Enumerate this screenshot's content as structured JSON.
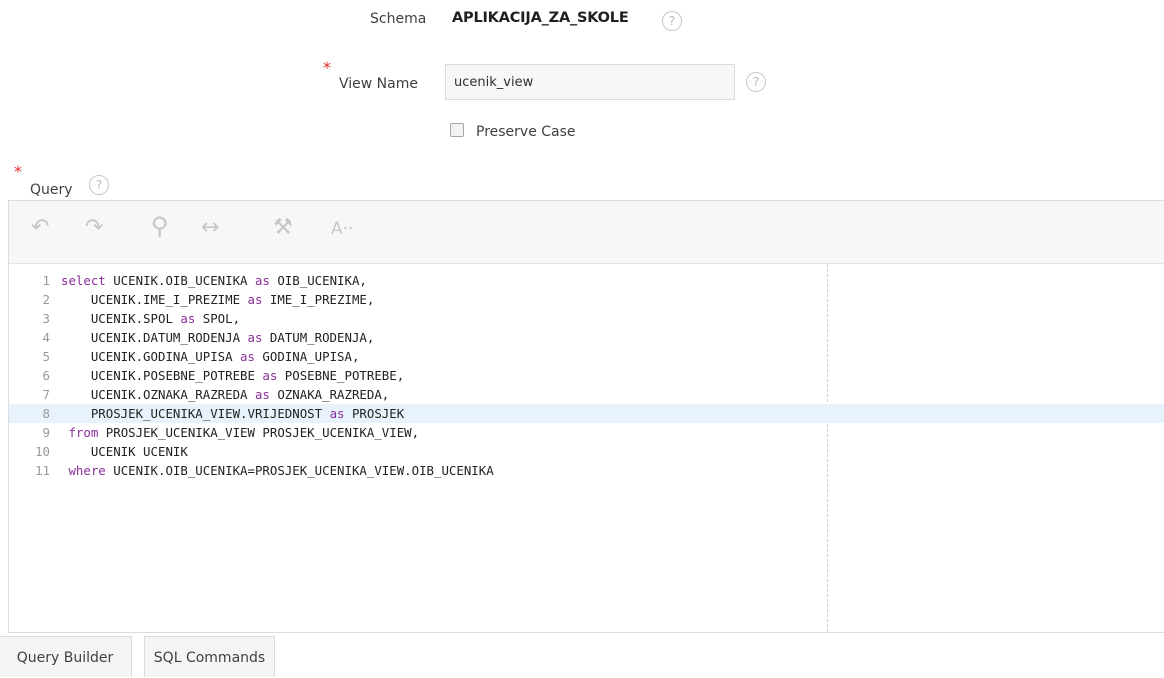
{
  "schema": {
    "label": "Schema",
    "value": "APLIKACIJA_ZA_SKOLE",
    "help": "?"
  },
  "view_name": {
    "required": "*",
    "label": "View Name",
    "value": "ucenik_view",
    "help": "?"
  },
  "preserve_case": {
    "label": "Preserve Case",
    "checked": false
  },
  "query": {
    "required": "*",
    "label": "Query",
    "help": "?",
    "toolbar": {
      "undo": "↶",
      "redo": "↷",
      "search": "⚲",
      "replace": "↔",
      "format": "⚒",
      "font": "A··"
    },
    "active_line": 8,
    "lines": [
      {
        "n": "1",
        "indent": "",
        "parts": [
          {
            "k": true,
            "t": "select"
          },
          {
            "k": false,
            "t": " UCENIK.OIB_UCENIKA "
          },
          {
            "k": true,
            "t": "as"
          },
          {
            "k": false,
            "t": " OIB_UCENIKA,"
          }
        ]
      },
      {
        "n": "2",
        "indent": "    ",
        "parts": [
          {
            "k": false,
            "t": "UCENIK.IME_I_PREZIME "
          },
          {
            "k": true,
            "t": "as"
          },
          {
            "k": false,
            "t": " IME_I_PREZIME,"
          }
        ]
      },
      {
        "n": "3",
        "indent": "    ",
        "parts": [
          {
            "k": false,
            "t": "UCENIK.SPOL "
          },
          {
            "k": true,
            "t": "as"
          },
          {
            "k": false,
            "t": " SPOL,"
          }
        ]
      },
      {
        "n": "4",
        "indent": "    ",
        "parts": [
          {
            "k": false,
            "t": "UCENIK.DATUM_RODENJA "
          },
          {
            "k": true,
            "t": "as"
          },
          {
            "k": false,
            "t": " DATUM_RODENJA,"
          }
        ]
      },
      {
        "n": "5",
        "indent": "    ",
        "parts": [
          {
            "k": false,
            "t": "UCENIK.GODINA_UPISA "
          },
          {
            "k": true,
            "t": "as"
          },
          {
            "k": false,
            "t": " GODINA_UPISA,"
          }
        ]
      },
      {
        "n": "6",
        "indent": "    ",
        "parts": [
          {
            "k": false,
            "t": "UCENIK.POSEBNE_POTREBE "
          },
          {
            "k": true,
            "t": "as"
          },
          {
            "k": false,
            "t": " POSEBNE_POTREBE,"
          }
        ]
      },
      {
        "n": "7",
        "indent": "    ",
        "parts": [
          {
            "k": false,
            "t": "UCENIK.OZNAKA_RAZREDA "
          },
          {
            "k": true,
            "t": "as"
          },
          {
            "k": false,
            "t": " OZNAKA_RAZREDA,"
          }
        ]
      },
      {
        "n": "8",
        "indent": "    ",
        "parts": [
          {
            "k": false,
            "t": "PROSJEK_UCENIKA_VIEW.VRIJEDNOST "
          },
          {
            "k": true,
            "t": "as"
          },
          {
            "k": false,
            "t": " PROSJEK"
          }
        ]
      },
      {
        "n": "9",
        "indent": " ",
        "parts": [
          {
            "k": true,
            "t": "from"
          },
          {
            "k": false,
            "t": " PROSJEK_UCENIKA_VIEW PROSJEK_UCENIKA_VIEW,"
          }
        ]
      },
      {
        "n": "10",
        "indent": "    ",
        "parts": [
          {
            "k": false,
            "t": "UCENIK UCENIK"
          }
        ]
      },
      {
        "n": "11",
        "indent": " ",
        "parts": [
          {
            "k": true,
            "t": "where"
          },
          {
            "k": false,
            "t": " UCENIK.OIB_UCENIKA=PROSJEK_UCENIKA_VIEW.OIB_UCENIKA"
          }
        ]
      }
    ]
  },
  "tabs": {
    "query_builder": "Query Builder",
    "sql_commands": "SQL Commands"
  },
  "colors": {
    "keyword": "#8a2f9a",
    "required": "#e0302b",
    "active_line": "#e8f2fd"
  }
}
